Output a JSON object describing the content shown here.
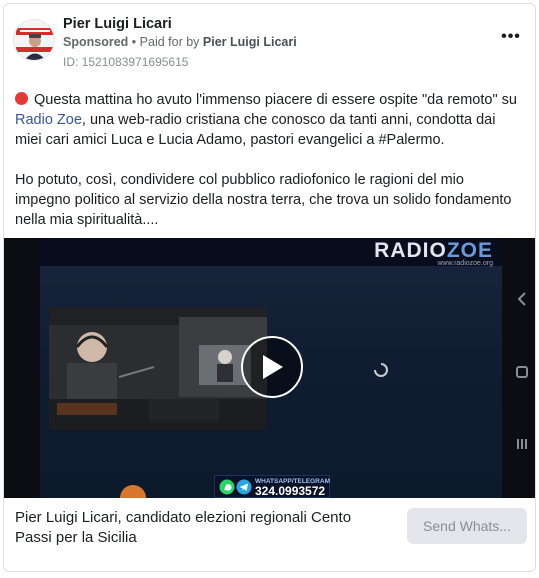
{
  "post": {
    "author": "Pier Luigi Licari",
    "sponsored": "Sponsored",
    "separator": "•",
    "paid_for_prefix": "Paid for by",
    "paid_for_name": "Pier Luigi Licari",
    "ad_id": "ID: 1521083971695615",
    "more_label": "•••"
  },
  "body": {
    "p1_before_link": "Questa mattina ho avuto l'immenso piacere di essere ospite \"da remoto\" su",
    "p1_link": "Radio Zoe",
    "p1_after_link": ", una web-radio cristiana che conosco da tanti anni, condotta dai miei cari amici Luca e Lucia Adamo, pastori evangelici a #Palermo.",
    "p2": "Ho potuto, così, condividere col pubblico radiofonico le ragioni del mio impegno politico al servizio della nostra terra, che trova un solido fondamento nella mia spiritualità...."
  },
  "video": {
    "logo_radio": "RADIO",
    "logo_zoe": "ZOE",
    "logo_url": "www.radiozoe.org",
    "contact_label": "WHATSAPP/TELEGRAM",
    "contact_phone": "324.0993572"
  },
  "footer": {
    "title": "Pier Luigi Licari, candidato elezioni regionali Cento Passi per la Sicilia",
    "cta_label": "Send Whats..."
  },
  "colors": {
    "accent": "#385898",
    "dot": "#e53935",
    "cta_bg": "#e4e6eb"
  },
  "icons": [
    "more-options-icon",
    "red-circle-icon",
    "play-icon",
    "whatsapp-icon",
    "telegram-icon",
    "back-icon",
    "square-icon",
    "menu-icon",
    "loading-spinner-icon"
  ]
}
